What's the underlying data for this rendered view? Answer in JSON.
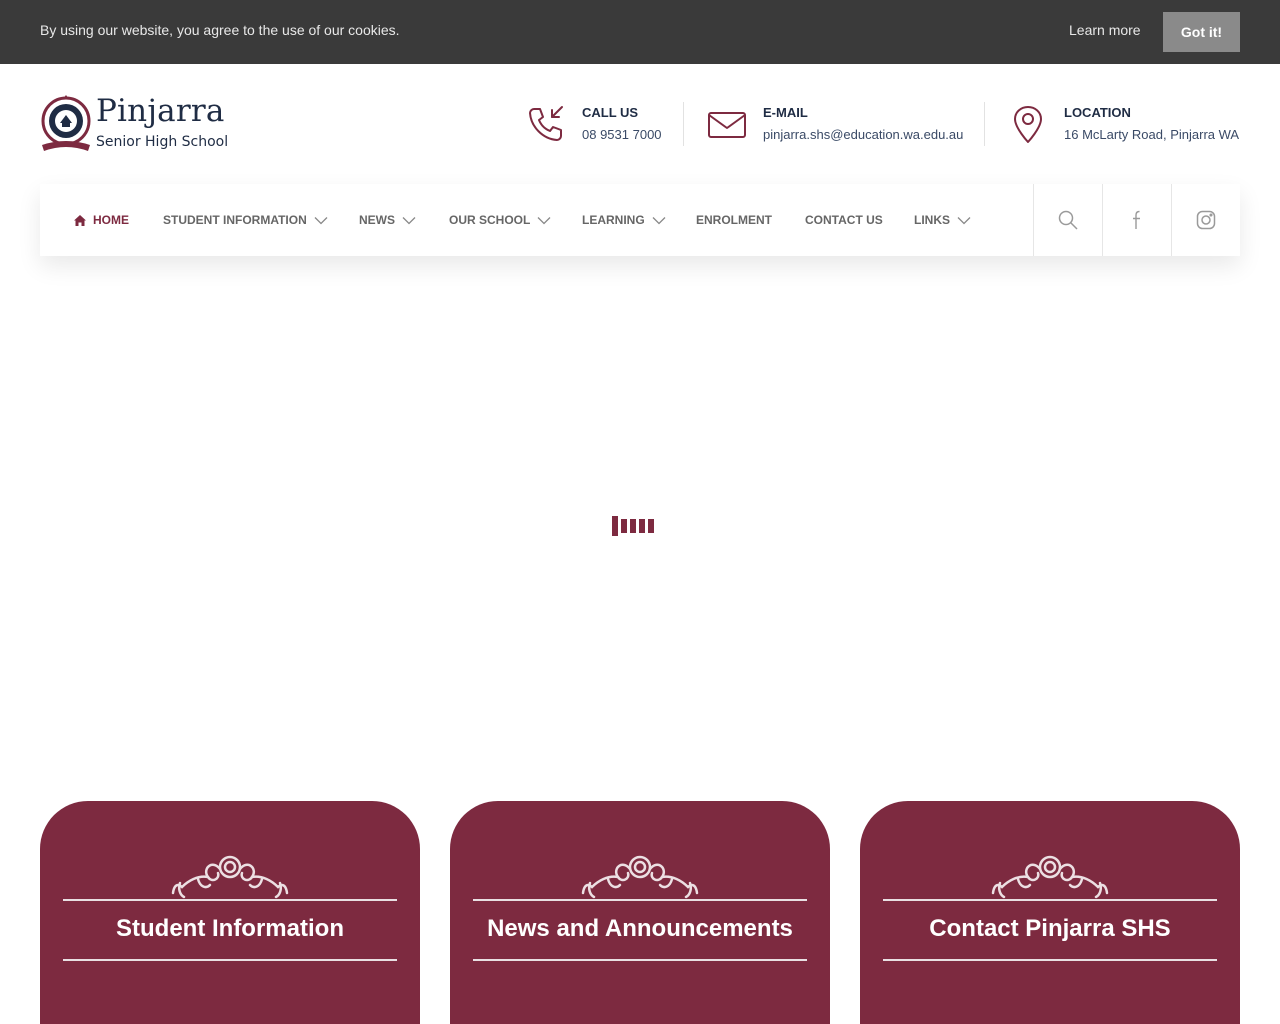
{
  "cookie": {
    "text": "By using our website, you agree to the use of our cookies.",
    "learn_more": "Learn more",
    "accept": "Got it!"
  },
  "brand": {
    "name": "Pinjarra",
    "subtitle": "Senior High School",
    "crest_icon": "school-crest-icon"
  },
  "contacts": [
    {
      "icon": "phone-incoming-icon",
      "label": "CALL US",
      "value": "08 9531 7000"
    },
    {
      "icon": "envelope-icon",
      "label": "E-MAIL",
      "value": "pinjarra.shs@education.wa.edu.au"
    },
    {
      "icon": "map-pin-icon",
      "label": "LOCATION",
      "value": "16 McLarty Road, Pinjarra WA"
    }
  ],
  "nav": {
    "items": [
      {
        "label": "HOME",
        "active": true,
        "dropdown": false
      },
      {
        "label": "STUDENT INFORMATION",
        "active": false,
        "dropdown": true
      },
      {
        "label": "NEWS",
        "active": false,
        "dropdown": true
      },
      {
        "label": "OUR SCHOOL",
        "active": false,
        "dropdown": true
      },
      {
        "label": "LEARNING",
        "active": false,
        "dropdown": true
      },
      {
        "label": "ENROLMENT",
        "active": false,
        "dropdown": false
      },
      {
        "label": "CONTACT US",
        "active": false,
        "dropdown": false
      },
      {
        "label": "LINKS",
        "active": false,
        "dropdown": true
      }
    ],
    "tools": [
      "search-icon",
      "facebook-icon",
      "instagram-icon"
    ]
  },
  "cards": [
    {
      "title": "Student Information"
    },
    {
      "title": "News and Announcements"
    },
    {
      "title": "Contact Pinjarra SHS"
    }
  ],
  "colors": {
    "accent": "#7d2a40",
    "navy": "#1f2c44",
    "cookie_bg": "#3a3a3a",
    "button_gray": "#8a8a8a"
  }
}
